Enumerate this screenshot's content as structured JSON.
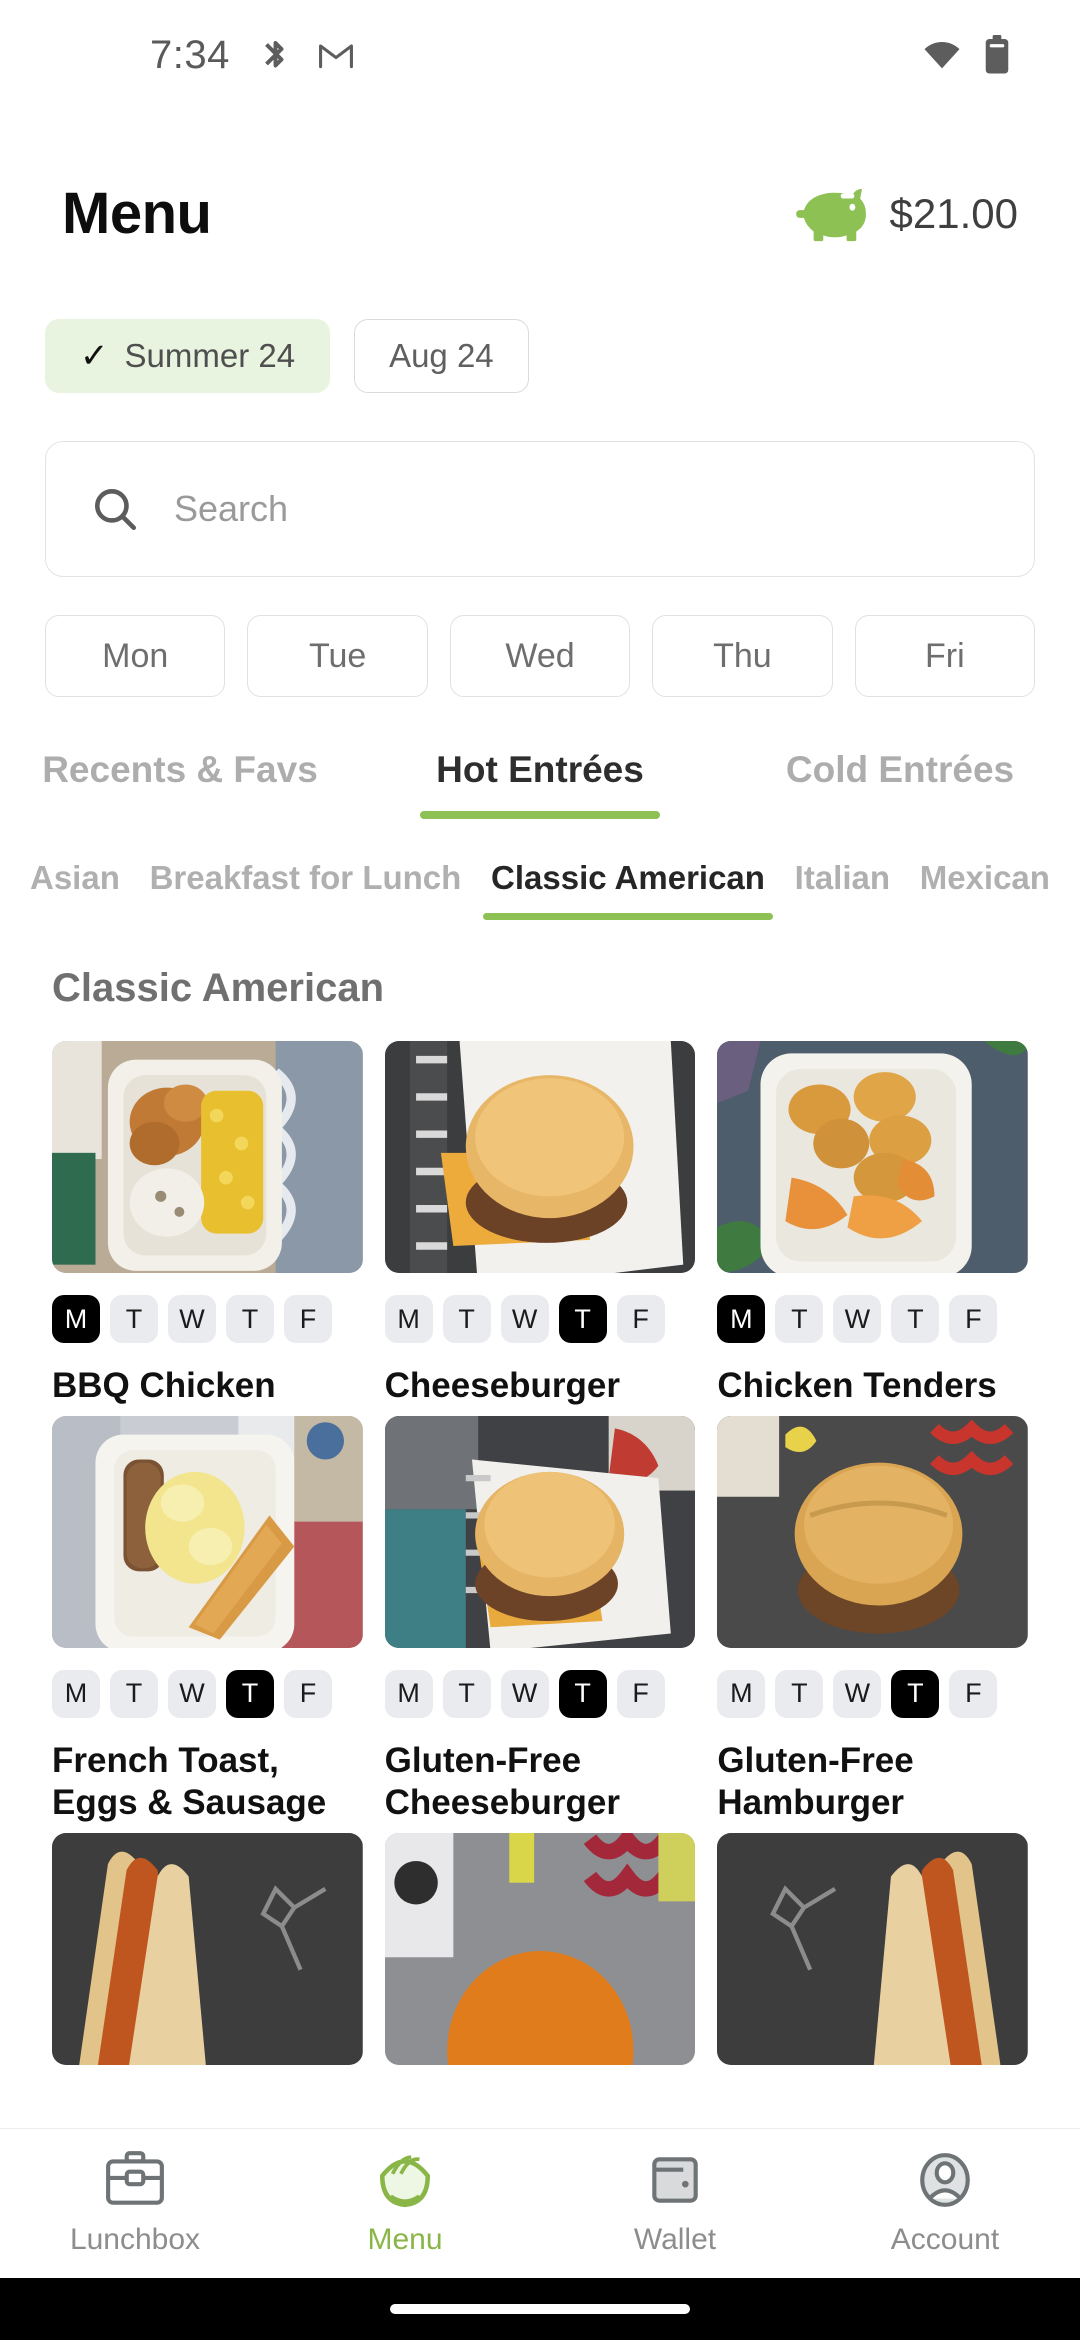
{
  "status_bar": {
    "time": "7:34",
    "left_icons": [
      "bluetooth-share-icon",
      "gmail-icon"
    ],
    "right_icons": [
      "wifi-icon",
      "battery-icon"
    ]
  },
  "header": {
    "title": "Menu",
    "balance_icon": "piggy-bank-icon",
    "balance": "$21.00",
    "accent_color": "#8ec153"
  },
  "period_chips": [
    {
      "label": "Summer 24",
      "selected": true,
      "check_icon": "check-icon"
    },
    {
      "label": "Aug 24",
      "selected": false
    }
  ],
  "search": {
    "icon": "search-icon",
    "placeholder": "Search",
    "value": ""
  },
  "day_chips": [
    {
      "label": "Mon",
      "selected": false
    },
    {
      "label": "Tue",
      "selected": false
    },
    {
      "label": "Wed",
      "selected": false
    },
    {
      "label": "Thu",
      "selected": false
    },
    {
      "label": "Fri",
      "selected": false
    }
  ],
  "tabs": [
    {
      "label": "Recents & Favs",
      "active": false
    },
    {
      "label": "Hot Entrées",
      "active": true
    },
    {
      "label": "Cold Entrées",
      "active": false
    }
  ],
  "subtabs": [
    {
      "label": "Asian",
      "active": false
    },
    {
      "label": "Breakfast for Lunch",
      "active": false
    },
    {
      "label": "Classic American",
      "active": true
    },
    {
      "label": "Italian",
      "active": false
    },
    {
      "label": "Mexican",
      "active": false
    }
  ],
  "section": {
    "title": "Classic American"
  },
  "day_badge_letters": [
    "M",
    "T",
    "W",
    "T",
    "F"
  ],
  "items": [
    {
      "title": "BBQ Chicken",
      "image": "bbq-chicken-tray-photo",
      "days": [
        true,
        false,
        false,
        false,
        false
      ]
    },
    {
      "title": "Cheeseburger",
      "image": "cheeseburger-photo",
      "days": [
        false,
        false,
        false,
        true,
        false
      ]
    },
    {
      "title": "Chicken Tenders",
      "image": "chicken-tenders-tray-photo",
      "days": [
        true,
        false,
        false,
        false,
        false
      ]
    },
    {
      "title": "French Toast, Eggs & Sausage",
      "image": "french-toast-eggs-sausage-photo",
      "days": [
        false,
        false,
        false,
        true,
        false
      ]
    },
    {
      "title": "Gluten-Free Cheeseburger",
      "image": "gluten-free-cheeseburger-photo",
      "days": [
        false,
        false,
        false,
        true,
        false
      ]
    },
    {
      "title": "Gluten-Free Hamburger",
      "image": "gluten-free-hamburger-photo",
      "days": [
        false,
        false,
        false,
        true,
        false
      ]
    },
    {
      "title": "",
      "image": "hot-dogs-photo",
      "days": []
    },
    {
      "title": "",
      "image": "burger-colorful-photo",
      "days": []
    },
    {
      "title": "",
      "image": "hot-dogs-photo-2",
      "days": []
    }
  ],
  "bottom_nav": [
    {
      "label": "Lunchbox",
      "icon": "lunchbox-icon",
      "active": false
    },
    {
      "label": "Menu",
      "icon": "bowl-icon",
      "active": true
    },
    {
      "label": "Wallet",
      "icon": "wallet-icon",
      "active": false
    },
    {
      "label": "Account",
      "icon": "account-icon",
      "active": false
    }
  ]
}
